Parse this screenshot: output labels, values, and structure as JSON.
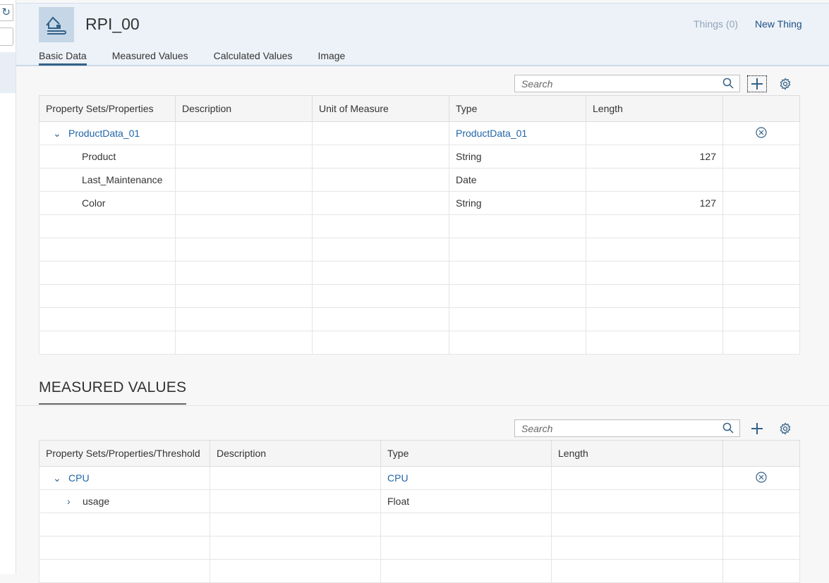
{
  "header": {
    "title": "RPI_00",
    "things_link": "Things (0)",
    "new_thing_link": "New Thing",
    "tabs": [
      {
        "label": "Basic Data",
        "active": true
      },
      {
        "label": "Measured Values"
      },
      {
        "label": "Calculated Values"
      },
      {
        "label": "Image"
      }
    ]
  },
  "basic": {
    "search_placeholder": "Search",
    "columns": [
      "Property Sets/Properties",
      "Description",
      "Unit of Measure",
      "Type",
      "Length",
      ""
    ],
    "rows": [
      {
        "name": "ProductData_01",
        "description": "",
        "unit": "",
        "type": "ProductData_01",
        "length": "",
        "group": true
      },
      {
        "name": "Product",
        "description": "",
        "unit": "",
        "type": "String",
        "length": "127"
      },
      {
        "name": "Last_Maintenance",
        "description": "",
        "unit": "",
        "type": "Date",
        "length": ""
      },
      {
        "name": "Color",
        "description": "",
        "unit": "",
        "type": "String",
        "length": "127"
      }
    ]
  },
  "measured": {
    "section_title": "MEASURED VALUES",
    "search_placeholder": "Search",
    "columns": [
      "Property Sets/Properties/Threshold",
      "Description",
      "Type",
      "Length",
      ""
    ],
    "rows": [
      {
        "name": "CPU",
        "description": "",
        "type": "CPU",
        "length": "",
        "group": true
      },
      {
        "name": "usage",
        "description": "",
        "type": "Float",
        "length": ""
      }
    ]
  },
  "colors": {
    "accent": "#346187",
    "link": "#1f65a8",
    "header_bg": "#edf2f8"
  }
}
